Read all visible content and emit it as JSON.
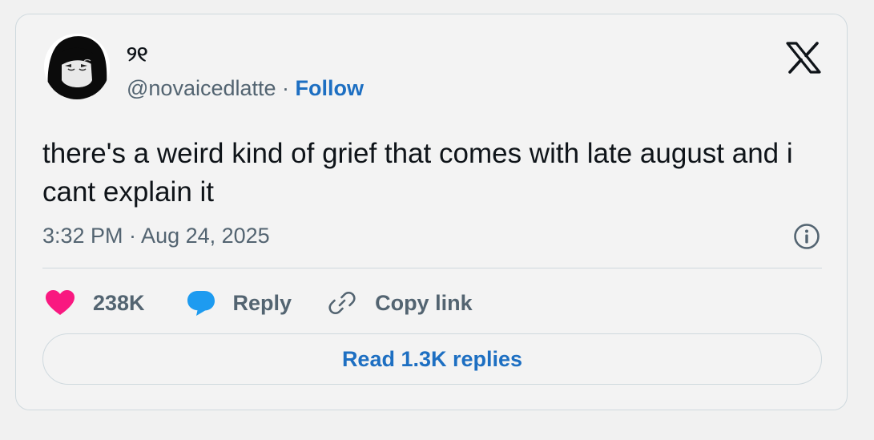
{
  "author": {
    "display_name": "୨୧",
    "handle": "@novaicedlatte",
    "separator": " · ",
    "follow_label": "Follow"
  },
  "tweet": {
    "text": "there's a weird kind of grief that comes with late august and i cant explain it",
    "timestamp": "3:32 PM · Aug 24, 2025"
  },
  "actions": {
    "likes": "238K",
    "reply_label": "Reply",
    "copy_label": "Copy link"
  },
  "read_replies_label": "Read 1.3K replies",
  "icons": {
    "brand": "x-logo-icon",
    "info": "info-icon",
    "like": "heart-icon",
    "reply": "speech-bubble-icon",
    "copy": "link-icon"
  },
  "colors": {
    "accent": "#1d6fc2",
    "heart": "#f91880",
    "reply_bubble": "#1d9bf0",
    "secondary_text": "#536471",
    "primary_text": "#0f1419",
    "border": "#cfd9de"
  }
}
